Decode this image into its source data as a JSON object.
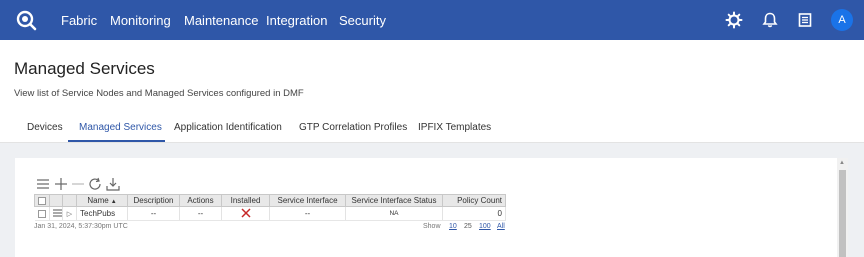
{
  "colors": {
    "nav_bg": "#2f57a8",
    "accent": "#2f57a8",
    "error": "#c62828",
    "avatar_bg": "#1a73e8"
  },
  "nav": {
    "logo_icon": "search-magnifier-logo-icon",
    "items": [
      "Fabric",
      "Monitoring",
      "Maintenance",
      "Integration",
      "Security"
    ],
    "icons": [
      "gear-icon",
      "bell-icon",
      "document-icon"
    ],
    "avatar": "A"
  },
  "page": {
    "title": "Managed Services",
    "subtitle": "View list of Service Nodes and Managed Services configured in DMF"
  },
  "tabs": [
    "Devices",
    "Managed Services",
    "Application Identification",
    "GTP Correlation Profiles",
    "IPFIX Templates"
  ],
  "active_tab": "Managed Services",
  "toolbar": {
    "icons": [
      "menu-icon",
      "add-icon",
      "remove-icon",
      "refresh-icon",
      "download-icon"
    ]
  },
  "table": {
    "columns": [
      "Name",
      "Description",
      "Actions",
      "Installed",
      "Service Interface",
      "Service Interface Status",
      "Policy Count"
    ],
    "sorted_column": "Name",
    "rows": [
      {
        "name": "TechPubs",
        "description": "--",
        "actions": "--",
        "installed": "x-icon",
        "service_interface": "--",
        "service_interface_status": "NA",
        "policy_count": "0"
      }
    ]
  },
  "footer": {
    "timestamp": "Jan 31, 2024, 5:37:30pm UTC",
    "show_label": "Show",
    "page_sizes": [
      "10",
      "25",
      "100",
      "All"
    ],
    "current_page_size": "25"
  }
}
